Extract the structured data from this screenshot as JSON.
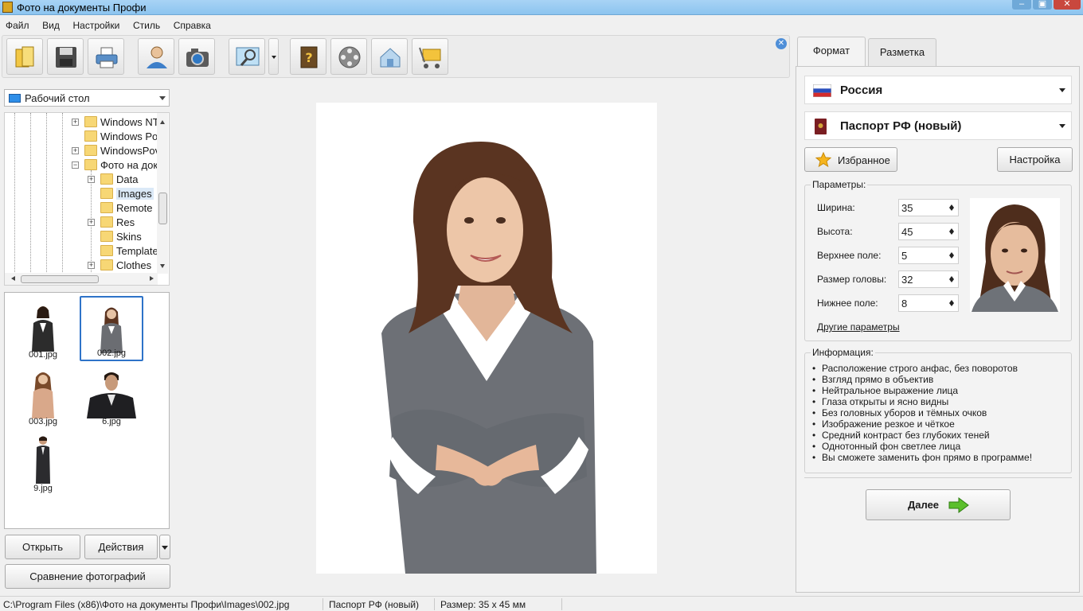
{
  "window": {
    "title": "Фото на документы Профи",
    "controls": [
      "–",
      "▣",
      "✕"
    ]
  },
  "menu": [
    "Файл",
    "Вид",
    "Настройки",
    "Стиль",
    "Справка"
  ],
  "toolbar": {
    "buttons": [
      {
        "name": "open-folder-icon"
      },
      {
        "name": "save-icon"
      },
      {
        "name": "print-icon"
      },
      {
        "name": "user-icon"
      },
      {
        "name": "camera-icon"
      },
      {
        "name": "photo-edit-icon"
      },
      {
        "name": "help-book-icon"
      },
      {
        "name": "video-reel-icon"
      },
      {
        "name": "website-icon"
      },
      {
        "name": "shop-cart-icon"
      }
    ],
    "close_badge": "✕"
  },
  "sidebar": {
    "location": "Рабочий стол",
    "tree": [
      {
        "label": "Windows NT",
        "level": 2,
        "expand": "+"
      },
      {
        "label": "Windows Po",
        "level": 2,
        "expand": ""
      },
      {
        "label": "WindowsPov",
        "level": 2,
        "expand": "+"
      },
      {
        "label": "Фото на док",
        "level": 2,
        "expand": "−"
      },
      {
        "label": "Data",
        "level": 3,
        "expand": "+"
      },
      {
        "label": "Images",
        "level": 3,
        "expand": "",
        "selected": true
      },
      {
        "label": "Remote",
        "level": 3,
        "expand": ""
      },
      {
        "label": "Res",
        "level": 3,
        "expand": "+"
      },
      {
        "label": "Skins",
        "level": 3,
        "expand": ""
      },
      {
        "label": "Template",
        "level": 3,
        "expand": ""
      },
      {
        "label": "Clothes",
        "level": 3,
        "expand": "+"
      }
    ],
    "thumbnails": [
      {
        "file": "001.jpg",
        "selected": false
      },
      {
        "file": "002.jpg",
        "selected": true
      },
      {
        "file": "003.jpg",
        "selected": false
      },
      {
        "file": "6.jpg",
        "selected": false
      },
      {
        "file": "9.jpg",
        "selected": false
      }
    ],
    "open_label": "Открыть",
    "actions_label": "Действия",
    "compare_label": "Сравнение фотографий"
  },
  "right": {
    "tabs": [
      "Формат",
      "Разметка"
    ],
    "active_tab": 0,
    "country": "Россия",
    "document": "Паспорт РФ (новый)",
    "favorites_label": "Избранное",
    "settings_label": "Настройка",
    "params": {
      "title": "Параметры:",
      "rows": [
        {
          "label": "Ширина:",
          "value": "35"
        },
        {
          "label": "Высота:",
          "value": "45"
        },
        {
          "label": "Верхнее поле:",
          "value": "5"
        },
        {
          "label": "Размер головы:",
          "value": "32"
        },
        {
          "label": "Нижнее поле:",
          "value": "8"
        }
      ],
      "more_link": "Другие параметры"
    },
    "info": {
      "title": "Информация:",
      "items": [
        "Расположение строго анфас, без поворотов",
        "Взгляд прямо в объектив",
        "Нейтральное выражение лица",
        "Глаза открыты и ясно видны",
        "Без головных уборов и тёмных очков",
        "Изображение резкое и чёткое",
        "Средний контраст без глубоких теней",
        "Однотонный фон светлее лица",
        "Вы сможете заменить фон прямо в программе!"
      ]
    },
    "next_label": "Далее"
  },
  "status": {
    "path": "C:\\Program Files (x86)\\Фото на документы Профи\\Images\\002.jpg",
    "format": "Паспорт РФ (новый)",
    "size": "Размер: 35 x 45 мм"
  },
  "colors": {
    "accent": "#2e73c8",
    "title_bar": "#a8d3f5",
    "next_arrow": "#5bbf2c"
  }
}
